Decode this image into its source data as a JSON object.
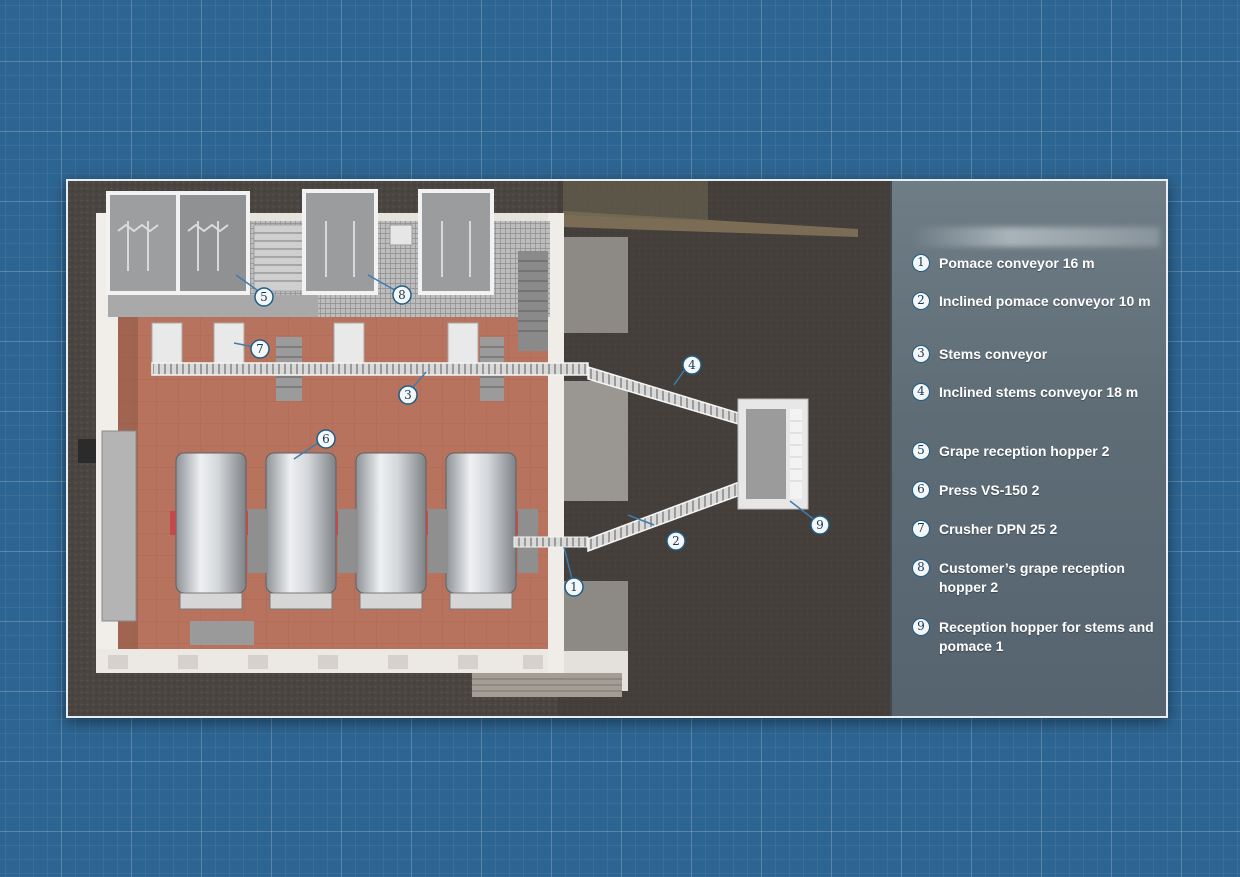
{
  "callouts": [
    {
      "num": "1",
      "label": "Pomace conveyor 16 m"
    },
    {
      "num": "2",
      "label": "Inclined pomace conveyor 10 m"
    },
    {
      "num": "3",
      "label": "Stems conveyor"
    },
    {
      "num": "4",
      "label": "Inclined stems conveyor 18 m"
    },
    {
      "num": "5",
      "label": "Grape reception hopper 2"
    },
    {
      "num": "6",
      "label": "Press VS-150 2"
    },
    {
      "num": "7",
      "label": "Crusher DPN 25 2"
    },
    {
      "num": "8",
      "label": "Customer’s grape reception hopper 2"
    },
    {
      "num": "9",
      "label": "Reception hopper for stems and pomace 1"
    }
  ],
  "colors": {
    "background_grid": "#2d6592",
    "floor": "#b6725e",
    "legend_panel": "#637079",
    "badge_border": "#1f5e86"
  }
}
